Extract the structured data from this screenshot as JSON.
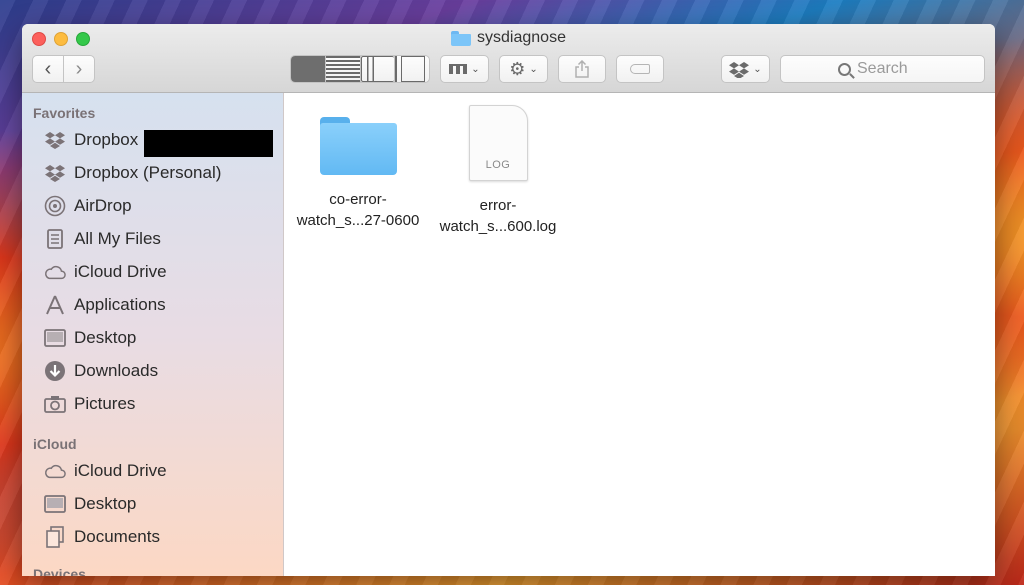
{
  "window": {
    "title": "sysdiagnose",
    "search_placeholder": "Search"
  },
  "toolbar": {
    "back": "‹",
    "forward": "›",
    "action_icon": "gear-icon",
    "share_icon": "share-icon",
    "dropbox_icon": "dropbox-icon"
  },
  "sidebar": {
    "favorites_header": "Favorites",
    "favorites": [
      {
        "label": "Dropbox",
        "icon": "dropbox-icon"
      },
      {
        "label": "Dropbox (Personal)",
        "icon": "dropbox-icon"
      },
      {
        "label": "AirDrop",
        "icon": "airdrop-icon"
      },
      {
        "label": "All My Files",
        "icon": "all-files-icon"
      },
      {
        "label": "iCloud Drive",
        "icon": "cloud-icon"
      },
      {
        "label": "Applications",
        "icon": "applications-icon"
      },
      {
        "label": "Desktop",
        "icon": "desktop-icon"
      },
      {
        "label": "Downloads",
        "icon": "downloads-icon"
      },
      {
        "label": "Pictures",
        "icon": "camera-icon"
      }
    ],
    "icloud_header": "iCloud",
    "icloud": [
      {
        "label": "iCloud Drive",
        "icon": "cloud-icon"
      },
      {
        "label": "Desktop",
        "icon": "desktop-icon"
      },
      {
        "label": "Documents",
        "icon": "documents-icon"
      }
    ],
    "devices_header": "Devices"
  },
  "files": [
    {
      "line1": "co-error-",
      "line2": "watch_s...27-0600",
      "type": "folder"
    },
    {
      "line1": "error-",
      "line2": "watch_s...600.log",
      "type": "log",
      "badge": "LOG"
    }
  ],
  "colors": {
    "accent_folder": "#7cc5f8",
    "close": "#fc605c",
    "minimize": "#fdbc40",
    "maximize": "#34c84a"
  }
}
